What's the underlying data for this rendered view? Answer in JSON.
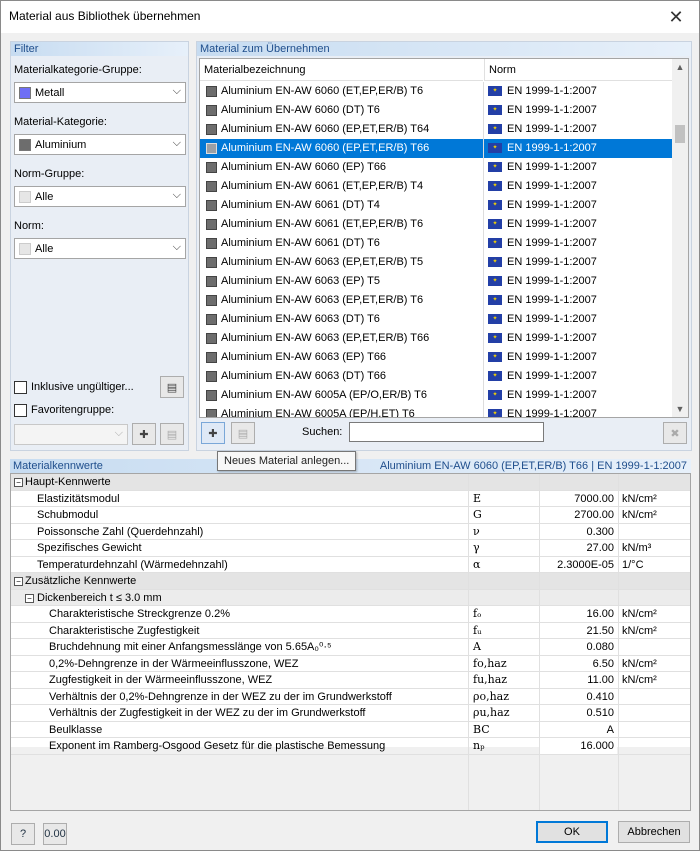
{
  "window": {
    "title": "Material aus Bibliothek übernehmen"
  },
  "filter": {
    "header": "Filter",
    "category_group_label": "Materialkategorie-Gruppe:",
    "category_group_value": "Metall",
    "category_group_color": "#6f6ff5",
    "category_label": "Material-Kategorie:",
    "category_value": "Aluminium",
    "category_color": "#6d6d6d",
    "norm_group_label": "Norm-Gruppe:",
    "norm_group_value": "Alle",
    "norm_label": "Norm:",
    "norm_value": "Alle",
    "include_invalid_label": "Inklusive ungültiger...",
    "favorites_label": "Favoritengruppe:"
  },
  "materials": {
    "header": "Material zum Übernehmen",
    "col_name": "Materialbezeichnung",
    "col_norm": "Norm",
    "rows": [
      {
        "name": "Aluminium EN-AW 6060 (ET,EP,ER/B) T6",
        "norm": "EN 1999-1-1:2007"
      },
      {
        "name": "Aluminium EN-AW 6060 (DT) T6",
        "norm": "EN 1999-1-1:2007"
      },
      {
        "name": "Aluminium EN-AW 6060 (EP,ET,ER/B) T64",
        "norm": "EN 1999-1-1:2007"
      },
      {
        "name": "Aluminium EN-AW 6060 (EP,ET,ER/B) T66",
        "norm": "EN 1999-1-1:2007"
      },
      {
        "name": "Aluminium EN-AW 6060 (EP) T66",
        "norm": "EN 1999-1-1:2007"
      },
      {
        "name": "Aluminium EN-AW 6061 (ET,EP,ER/B) T4",
        "norm": "EN 1999-1-1:2007"
      },
      {
        "name": "Aluminium EN-AW 6061 (DT) T4",
        "norm": "EN 1999-1-1:2007"
      },
      {
        "name": "Aluminium EN-AW 6061 (ET,EP,ER/B) T6",
        "norm": "EN 1999-1-1:2007"
      },
      {
        "name": "Aluminium EN-AW 6061 (DT) T6",
        "norm": "EN 1999-1-1:2007"
      },
      {
        "name": "Aluminium EN-AW 6063 (EP,ET,ER/B) T5",
        "norm": "EN 1999-1-1:2007"
      },
      {
        "name": "Aluminium EN-AW 6063 (EP) T5",
        "norm": "EN 1999-1-1:2007"
      },
      {
        "name": "Aluminium EN-AW 6063 (EP,ET,ER/B) T6",
        "norm": "EN 1999-1-1:2007"
      },
      {
        "name": "Aluminium EN-AW 6063 (DT) T6",
        "norm": "EN 1999-1-1:2007"
      },
      {
        "name": "Aluminium EN-AW 6063 (EP,ET,ER/B) T66",
        "norm": "EN 1999-1-1:2007"
      },
      {
        "name": "Aluminium EN-AW 6063 (EP) T66",
        "norm": "EN 1999-1-1:2007"
      },
      {
        "name": "Aluminium EN-AW 6063 (DT) T66",
        "norm": "EN 1999-1-1:2007"
      },
      {
        "name": "Aluminium EN-AW 6005A (EP/O,ER/B) T6",
        "norm": "EN 1999-1-1:2007"
      },
      {
        "name": "Aluminium EN-AW 6005A (EP/H,ET) T6",
        "norm": "EN 1999-1-1:2007"
      }
    ],
    "selected_index": 3,
    "search_label": "Suchen:",
    "search_value": "",
    "new_material_tooltip": "Neues Material anlegen..."
  },
  "properties": {
    "header": "Materialkennwerte",
    "selected_summary": "Aluminium EN-AW 6060 (EP,ET,ER/B) T66  |  EN 1999-1-1:2007",
    "main_group": "Haupt-Kennwerte",
    "main": [
      {
        "name": "Elastizitätsmodul",
        "sym": "E",
        "value": "7000.00",
        "unit": "kN/cm²"
      },
      {
        "name": "Schubmodul",
        "sym": "G",
        "value": "2700.00",
        "unit": "kN/cm²"
      },
      {
        "name": "Poissonsche Zahl (Querdehnzahl)",
        "sym": "ν",
        "value": "0.300",
        "unit": ""
      },
      {
        "name": "Spezifisches Gewicht",
        "sym": "γ",
        "value": "27.00",
        "unit": "kN/m³"
      },
      {
        "name": "Temperaturdehnzahl (Wärmedehnzahl)",
        "sym": "α",
        "value": "2.3000E-05",
        "unit": "1/°C"
      }
    ],
    "extra_group": "Zusätzliche Kennwerte",
    "thickness_group": "Dickenbereich t ≤ 3.0 mm",
    "extra": [
      {
        "name": "Charakteristische Streckgrenze 0.2%",
        "sym": "fₒ",
        "value": "16.00",
        "unit": "kN/cm²"
      },
      {
        "name": "Charakteristische Zugfestigkeit",
        "sym": "fᵤ",
        "value": "21.50",
        "unit": "kN/cm²"
      },
      {
        "name": "Bruchdehnung mit einer Anfangsmesslänge von 5.65A₀⁰·⁵",
        "sym": "A",
        "value": "0.080",
        "unit": ""
      },
      {
        "name": "0,2%-Dehngrenze in der Wärmeeinflusszone, WEZ",
        "sym": "fo,haz",
        "value": "6.50",
        "unit": "kN/cm²"
      },
      {
        "name": "Zugfestigkeit in der Wärmeeinflusszone, WEZ",
        "sym": "fu,haz",
        "value": "11.00",
        "unit": "kN/cm²"
      },
      {
        "name": "Verhältnis der 0,2%-Dehngrenze in der WEZ zu der im Grundwerkstoff",
        "sym": "ρo,haz",
        "value": "0.410",
        "unit": ""
      },
      {
        "name": "Verhältnis der Zugfestigkeit in der WEZ zu der im Grundwerkstoff",
        "sym": "ρu,haz",
        "value": "0.510",
        "unit": ""
      },
      {
        "name": "Beulklasse",
        "sym": "BC",
        "value": "A",
        "unit": ""
      },
      {
        "name": "Exponent im Ramberg-Osgood Gesetz für die plastische Bemessung",
        "sym": "nₚ",
        "value": "16.000",
        "unit": ""
      }
    ]
  },
  "footer": {
    "ok_label": "OK",
    "cancel_label": "Abbrechen",
    "units_icon_text": "0.00"
  }
}
